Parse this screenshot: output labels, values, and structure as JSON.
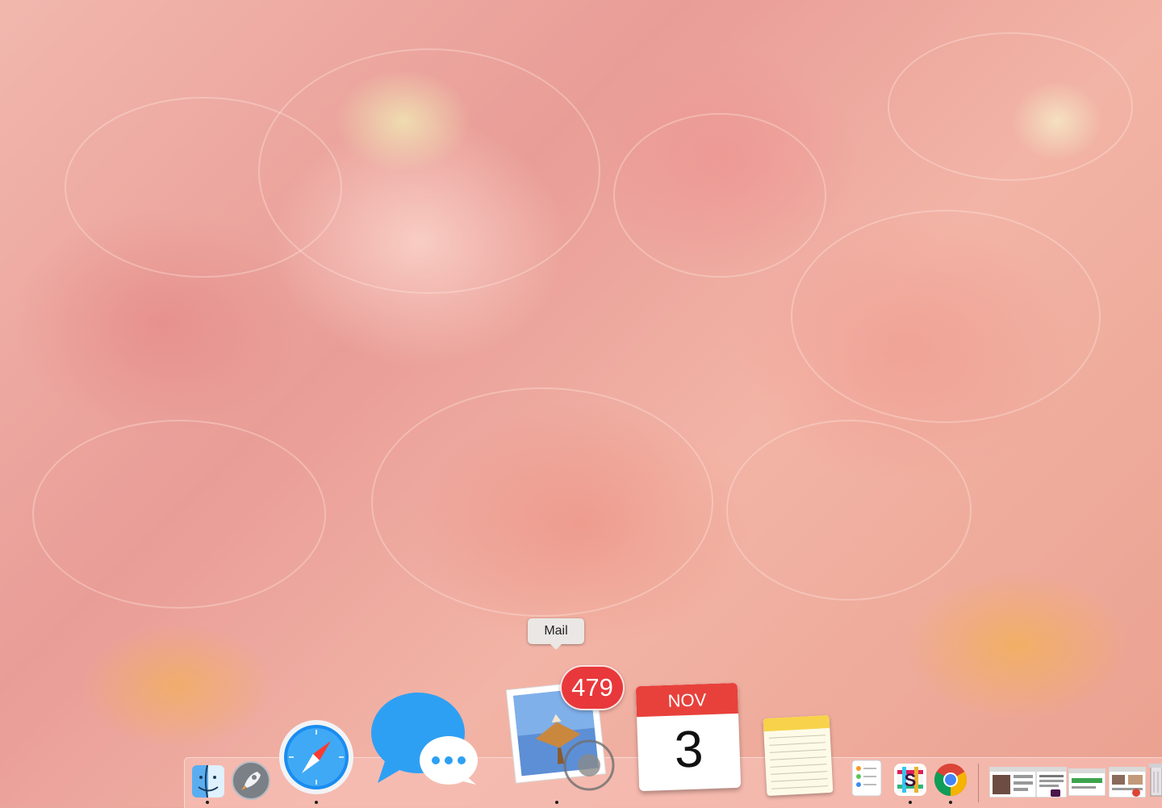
{
  "tooltip": {
    "label": "Mail"
  },
  "mail": {
    "badge_count": "479"
  },
  "calendar": {
    "month": "NOV",
    "day": "3"
  },
  "dock": {
    "items": [
      {
        "name": "finder",
        "icon": "finder-icon",
        "running": true
      },
      {
        "name": "launchpad",
        "icon": "rocket-icon",
        "running": false
      },
      {
        "name": "safari",
        "icon": "compass-icon",
        "running": true
      },
      {
        "name": "messages",
        "icon": "speech-bubble-icon",
        "running": false
      },
      {
        "name": "mail",
        "icon": "stamp-icon",
        "running": true
      },
      {
        "name": "calendar",
        "icon": "calendar-icon",
        "running": false
      },
      {
        "name": "notes",
        "icon": "notepad-icon",
        "running": false
      },
      {
        "name": "reminders",
        "icon": "checklist-icon",
        "running": false
      },
      {
        "name": "slack",
        "icon": "slack-icon",
        "running": true
      },
      {
        "name": "chrome",
        "icon": "chrome-icon",
        "running": true
      },
      {
        "name": "minimized-window-1",
        "icon": "window-thumbnail-icon",
        "running": false
      },
      {
        "name": "minimized-window-2",
        "icon": "window-thumbnail-icon",
        "running": false
      },
      {
        "name": "minimized-window-3",
        "icon": "window-thumbnail-icon",
        "running": false
      },
      {
        "name": "minimized-window-4",
        "icon": "window-thumbnail-icon",
        "running": false
      },
      {
        "name": "trash",
        "icon": "trash-icon",
        "running": false
      }
    ]
  },
  "colors": {
    "badge": "#e8383b",
    "calendar_header": "#e8413b",
    "dock_tint": "#f6beb4"
  }
}
